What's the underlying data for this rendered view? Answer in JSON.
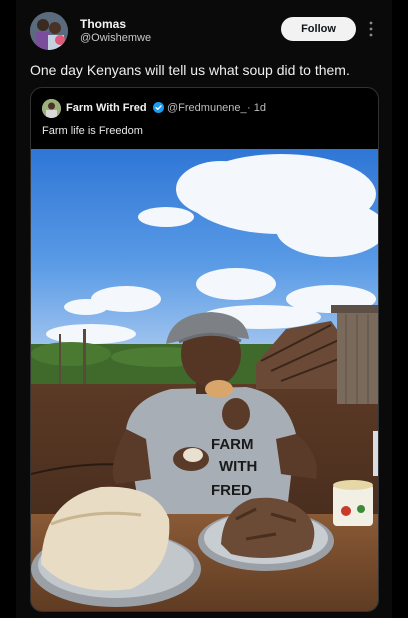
{
  "post": {
    "author_name": "Thomas",
    "author_handle": "@Owishemwe",
    "follow_label": "Follow",
    "text": "One day Kenyans will tell us what soup did to them."
  },
  "quoted_post": {
    "author_name": "Farm With Fred",
    "author_handle": "@Fredmunene_",
    "time": "· 1d",
    "text": "Farm life is Freedom",
    "shirt_print": [
      "FARM",
      "WITH",
      "FRED"
    ]
  },
  "icons": {
    "more": "more-vertical-icon",
    "verified": "verified-badge-icon"
  },
  "colors": {
    "background": "#000000",
    "follow_bg": "#f2f2f2",
    "verified": "#1d9bf0",
    "text": "#e7e9ea",
    "muted": "#bdbdbd"
  }
}
